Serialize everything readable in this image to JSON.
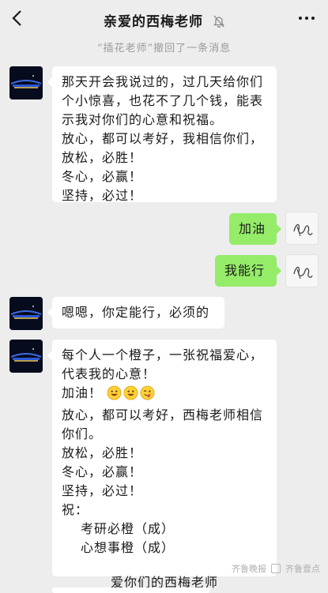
{
  "header": {
    "title": "亲爱的西梅老师"
  },
  "system_message": "“插花老师”撤回了一条消息",
  "messages": {
    "m1": {
      "lines": [
        "那天开会我说过的，过几天给你们",
        "个小惊喜，也花不了几个钱，能表",
        "示我对你们的心意和祝福。",
        "放心，都可以考好，我相信你们，",
        "放松，必胜！",
        "冬心，必赢！",
        "坚持，必过！"
      ]
    },
    "m2": {
      "text": "加油"
    },
    "m3": {
      "text": "我能行"
    },
    "m4": {
      "text": "嗯嗯，你定能行，必须的"
    },
    "m5": {
      "lines": [
        "每个人一个橙子，一张祝福爱心，",
        "代表我的心意！",
        "加油！",
        "放心，都可以考好，西梅老师相信",
        "你们。",
        "放松，必胜！",
        "冬心，必赢！",
        "坚持，必过！",
        "祝："
      ],
      "wishes": [
        "考研必橙（成）",
        "心想事橙（成）"
      ],
      "signature": "爱你们的西梅老师"
    }
  },
  "watermark": {
    "text1": "齐鲁晚报",
    "text2": "齐鲁壹点"
  },
  "colors": {
    "background": "#ededed",
    "bubble_self": "#95ec69",
    "bubble_other": "#ffffff"
  },
  "icons": [
    "back-arrow-icon",
    "mute-bell-icon",
    "more-icon",
    "grinning-emoji-icon",
    "winking-tongue-emoji-icon"
  ]
}
